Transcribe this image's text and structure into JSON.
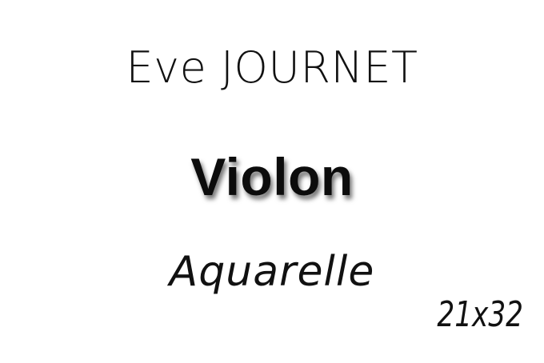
{
  "label": {
    "author": "Eve JOURNET",
    "title": "Violon",
    "medium": "Aquarelle",
    "size": "21x32"
  }
}
